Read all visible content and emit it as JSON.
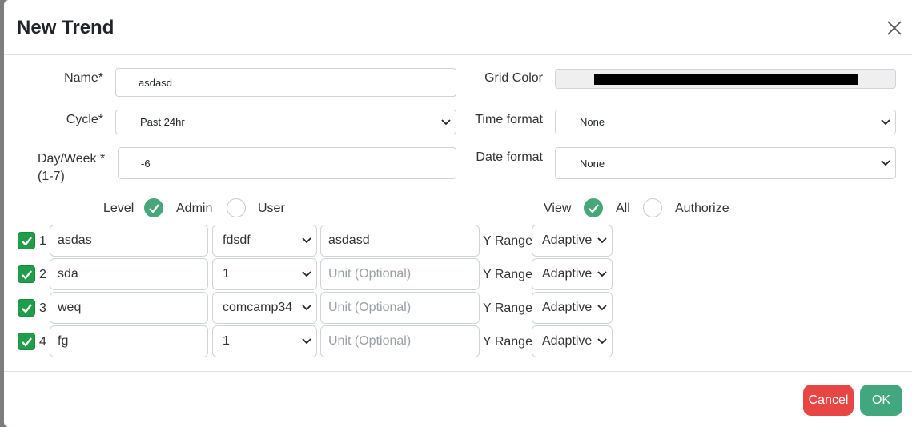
{
  "dialog": {
    "title": "New Trend",
    "cancel_label": "Cancel",
    "ok_label": "OK"
  },
  "form": {
    "name_label": "Name*",
    "name_value": "asdasd",
    "cycle_label": "Cycle*",
    "cycle_value": "Past 24hr",
    "dayweek_label_line1": "Day/Week *",
    "dayweek_label_line2": "(1-7)",
    "dayweek_value": "-6",
    "grid_color_label": "Grid Color",
    "grid_color_value": "#000000",
    "time_format_label": "Time format",
    "time_format_value": "None",
    "date_format_label": "Date format",
    "date_format_value": "None"
  },
  "level": {
    "label": "Level",
    "options": [
      {
        "label": "Admin",
        "selected": true
      },
      {
        "label": "User",
        "selected": false
      }
    ]
  },
  "view": {
    "label": "View",
    "options": [
      {
        "label": "All",
        "selected": true
      },
      {
        "label": "Authorize",
        "selected": false
      }
    ]
  },
  "rows": [
    {
      "checked": true,
      "num": "1",
      "name": "asdas",
      "tag": "fdsdf",
      "unit": "asdasd",
      "unit_placeholder": "Unit (Optional)",
      "yrange_label": "Y Range",
      "yrange": "Adaptive"
    },
    {
      "checked": true,
      "num": "2",
      "name": "sda",
      "tag": "1",
      "unit": "",
      "unit_placeholder": "Unit (Optional)",
      "yrange_label": "Y Range",
      "yrange": "Adaptive"
    },
    {
      "checked": true,
      "num": "3",
      "name": "weq",
      "tag": "comcamp34",
      "unit": "",
      "unit_placeholder": "Unit (Optional)",
      "yrange_label": "Y Range",
      "yrange": "Adaptive"
    },
    {
      "checked": true,
      "num": "4",
      "name": "fg",
      "tag": "1",
      "unit": "",
      "unit_placeholder": "Unit (Optional)",
      "yrange_label": "Y Range",
      "yrange": "Adaptive"
    }
  ],
  "colors": {
    "accent_green": "#48a77a",
    "checkbox_green": "#1f9d48",
    "cancel_red": "#e84545",
    "ok_green": "#41a87e"
  },
  "icons": {
    "close": "close-icon",
    "select_chevron": "chevron-down-icon",
    "check": "check-icon"
  }
}
